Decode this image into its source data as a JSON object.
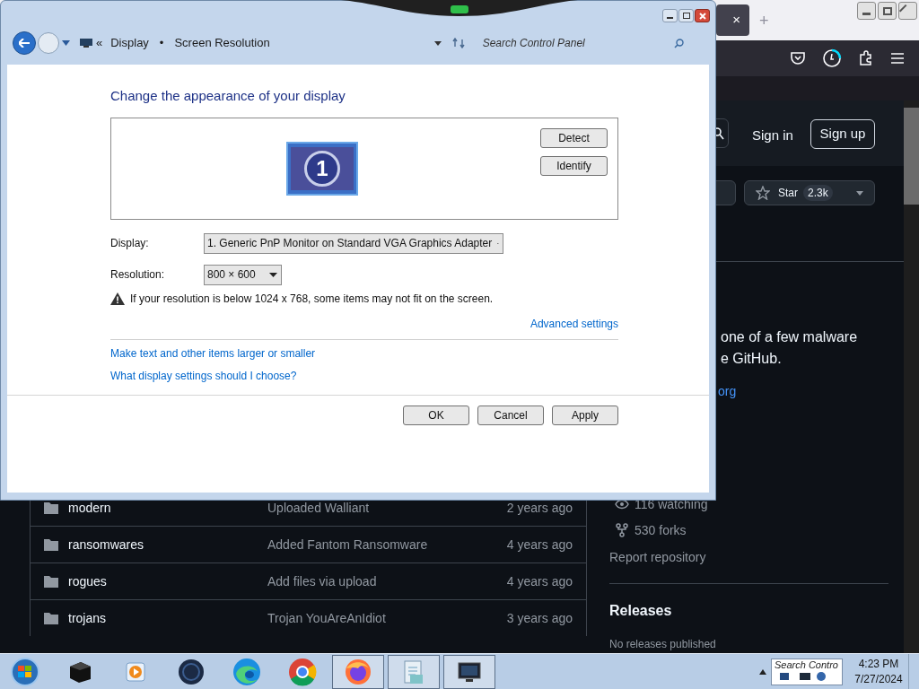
{
  "browser": {
    "tab": {
      "close": "×",
      "new_tab": "+"
    },
    "github": {
      "sign_in": "Sign in",
      "sign_up": "Sign up",
      "star": {
        "label": "Star",
        "count": "2.3k"
      },
      "about": {
        "lines": [
          "one of a few malware",
          "e GitHub."
        ],
        "link": "org"
      },
      "files": [
        {
          "name": "modern",
          "message": "Uploaded Walliant",
          "age": "2 years ago"
        },
        {
          "name": "ransomwares",
          "message": "Added Fantom Ransomware",
          "age": "4 years ago"
        },
        {
          "name": "rogues",
          "message": "Add files via upload",
          "age": "4 years ago"
        },
        {
          "name": "trojans",
          "message": "Trojan YouAreAnIdiot",
          "age": "3 years ago"
        }
      ],
      "stats": [
        {
          "kind": "eye",
          "text": "116 watching"
        },
        {
          "kind": "fork",
          "text": "530 forks"
        }
      ],
      "report": "Report repository",
      "releases": {
        "title": "Releases",
        "empty": "No releases published"
      }
    }
  },
  "dialog": {
    "breadcrumb_overflow": "«",
    "breadcrumb": [
      "Display",
      "Screen Resolution"
    ],
    "breadcrumb_separator": "•",
    "search_placeholder": "Search Control Panel",
    "heading": "Change the appearance of your display",
    "monitor_number": "1",
    "side_buttons": [
      "Detect",
      "Identify"
    ],
    "fields": [
      {
        "label": "Display:",
        "value": "1. Generic PnP Monitor on Standard VGA Graphics Adapter"
      },
      {
        "label": "Resolution:",
        "value": "800 × 600"
      }
    ],
    "warning": "If your resolution is below 1024 x 768, some items may not fit on the screen.",
    "advanced_link": "Advanced settings",
    "links": [
      "Make text and other items larger or smaller",
      "What display settings should I choose?"
    ],
    "buttons": [
      "OK",
      "Cancel",
      "Apply"
    ]
  },
  "taskbar": {
    "apps": [
      {
        "kind": "box",
        "open": false
      },
      {
        "kind": "media",
        "open": false
      },
      {
        "kind": "sphere",
        "open": false
      },
      {
        "kind": "edge",
        "open": false
      },
      {
        "kind": "chrome",
        "open": false
      },
      {
        "kind": "firefox",
        "open": true
      },
      {
        "kind": "document",
        "open": true
      },
      {
        "kind": "monitor",
        "open": true
      }
    ],
    "thumbnail": "Search Contro",
    "time": "4:23 PM",
    "date": "7/27/2024"
  }
}
